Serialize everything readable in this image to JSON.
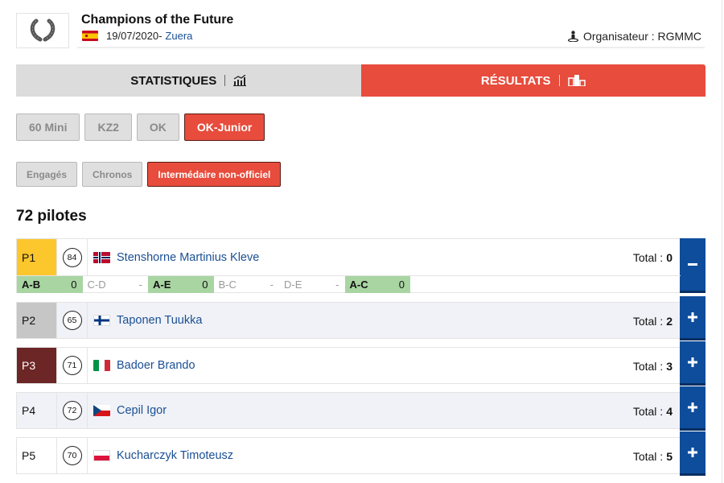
{
  "event": {
    "title": "Champions of the Future",
    "date": "19/07/2020",
    "date_sep": " -",
    "location": "Zuera",
    "country_flag": "spain-flag",
    "organizer_label": "Organisateur : RGMMC",
    "logo_icon": "laurel-wreath-icon"
  },
  "tabs": [
    {
      "label": "STATISTIQUES",
      "icon": "bar-chart-icon",
      "active": false
    },
    {
      "label": "RÉSULTATS",
      "icon": "podium-icon",
      "active": true
    }
  ],
  "categories": [
    {
      "label": "60 Mini",
      "active": false
    },
    {
      "label": "KZ2",
      "active": false
    },
    {
      "label": "OK",
      "active": false
    },
    {
      "label": "OK-Junior",
      "active": true
    }
  ],
  "result_types": [
    {
      "label": "Engagés",
      "active": false
    },
    {
      "label": "Chronos",
      "active": false
    },
    {
      "label": "Intermédaire non-officiel",
      "active": true
    }
  ],
  "drivers_count": "72 pilotes",
  "total_label": "Total :",
  "rows": [
    {
      "position": "P1",
      "number": "84",
      "name": "Stenshorne Martinius Kleve",
      "country": "norway",
      "total": "0",
      "expanded": true,
      "heats": [
        {
          "label": "A-B",
          "value": "0",
          "raced": true
        },
        {
          "label": "C-D",
          "value": "-",
          "raced": false
        },
        {
          "label": "A-E",
          "value": "0",
          "raced": true
        },
        {
          "label": "B-C",
          "value": "-",
          "raced": false
        },
        {
          "label": "D-E",
          "value": "-",
          "raced": false
        },
        {
          "label": "A-C",
          "value": "0",
          "raced": true
        }
      ]
    },
    {
      "position": "P2",
      "number": "65",
      "name": "Taponen Tuukka",
      "country": "finland",
      "total": "2",
      "expanded": false
    },
    {
      "position": "P3",
      "number": "71",
      "name": "Badoer Brando",
      "country": "italy",
      "total": "3",
      "expanded": false
    },
    {
      "position": "P4",
      "number": "72",
      "name": "Cepil Igor",
      "country": "czech-republic",
      "total": "4",
      "expanded": false
    },
    {
      "position": "P5",
      "number": "70",
      "name": "Kucharczyk Timoteusz",
      "country": "poland",
      "total": "5",
      "expanded": false
    }
  ],
  "colors": {
    "accent_red": "#e74c3c",
    "toggle_blue": "#0e4d9c",
    "p1_gold": "#fcc62d",
    "p2_silver": "#c6c6c6",
    "p3_bronze": "#6d2626",
    "heat_green": "#a8d5a2",
    "link_blue": "#1a4f94"
  }
}
